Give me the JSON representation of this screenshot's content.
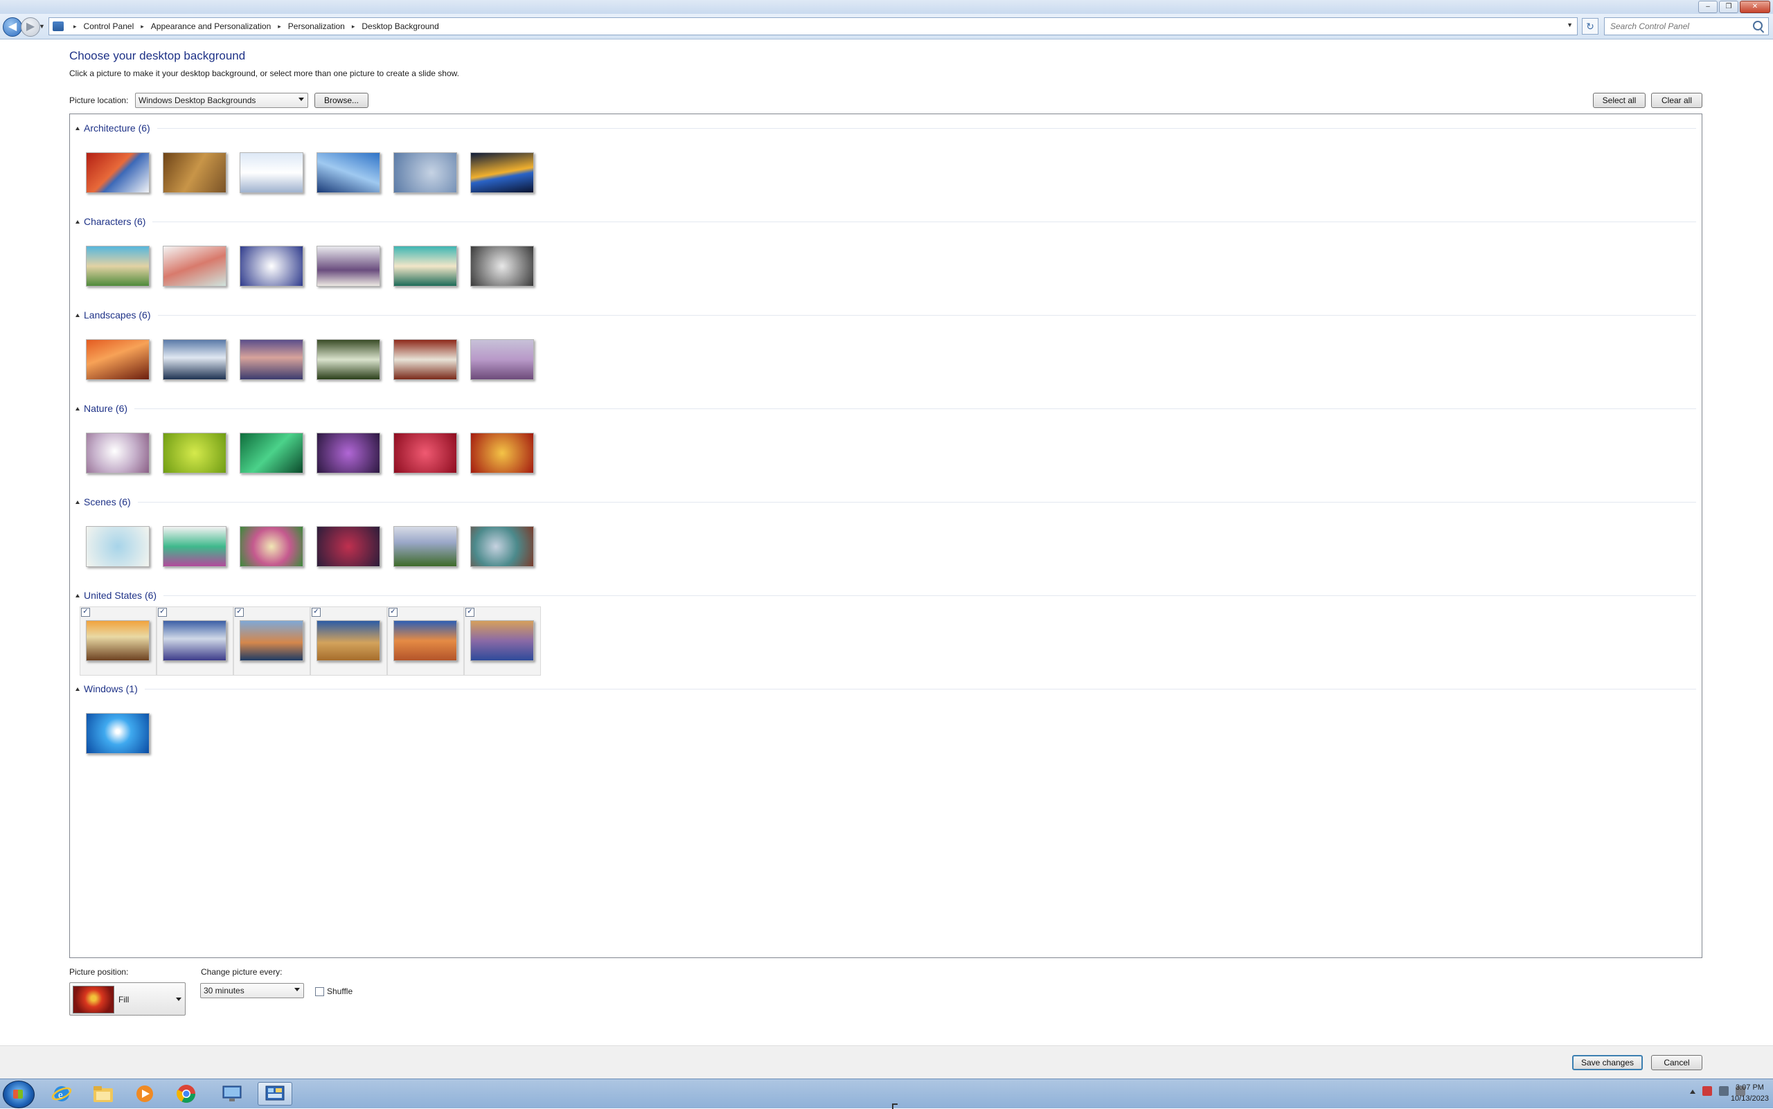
{
  "window": {
    "controls": [
      "–",
      "❐",
      "✕"
    ]
  },
  "nav": {
    "breadcrumb": [
      "Control Panel",
      "Appearance and Personalization",
      "Personalization",
      "Desktop Background"
    ],
    "search_placeholder": "Search Control Panel"
  },
  "page": {
    "heading": "Choose your desktop background",
    "subtitle": "Click a picture to make it your desktop background, or select more than one picture to create a slide show.",
    "location_label": "Picture location:",
    "location_value": "Windows Desktop Backgrounds",
    "browse_label": "Browse...",
    "select_all_label": "Select all",
    "clear_all_label": "Clear all"
  },
  "groups": [
    {
      "title": "Architecture (6)",
      "selected": false,
      "thumbs": [
        "linear-gradient(135deg,#b32014,#e86a3a 45%,#3c69b8 55%,#f0f2f6)",
        "linear-gradient(120deg,#6e4418,#c89548 50%,#7a5327)",
        "linear-gradient(180deg,#dde8f6,#ffffff 50%,#9fb2cf)",
        "linear-gradient(200deg,#2f73c7,#9fc9f0 50%,#1a3b78)",
        "radial-gradient(circle at 60% 50%,#c6d3e4,#5a7aa6)",
        "linear-gradient(170deg,#0d1b3a,#f1b02e 50%,#2a63c6 60%,#0b1430)"
      ]
    },
    {
      "title": "Characters (6)",
      "selected": false,
      "thumbs": [
        "linear-gradient(180deg,#57b6dc,#e2d2a4 50%,#4f8a3b)",
        "linear-gradient(160deg,#f4f4f4,#d87a6c 50%,#cfe3dd)",
        "radial-gradient(circle at 50% 50%,#ffffff,#2f3b8c)",
        "linear-gradient(180deg,#e9e9ed,#6a4d7e 60%,#ece8e2)",
        "linear-gradient(180deg,#3fb6b3,#f2e6c8 50%,#1d6b58)",
        "radial-gradient(circle at 50% 50%,#e8e8e8,#3a3a3a)"
      ]
    },
    {
      "title": "Landscapes (6)",
      "selected": false,
      "thumbs": [
        "linear-gradient(160deg,#e35b21,#f7a257 40%,#6b1e0e)",
        "linear-gradient(180deg,#5a7aa8,#dfe7f1 45%,#1f3352)",
        "linear-gradient(180deg,#5b4e8a,#d7a39b 45%,#3c3b6e)",
        "linear-gradient(180deg,#3a4c27,#d9e2cc 50%,#2b3f1a)",
        "linear-gradient(180deg,#8e2a1b,#e8e2d6 50%,#7a2a1a)",
        "linear-gradient(180deg,#c7c1d8,#b899c8 50%,#6d4b7a)"
      ]
    },
    {
      "title": "Nature (6)",
      "selected": false,
      "thumbs": [
        "radial-gradient(circle at 45% 45%,#ffffff,#c7b2cc 50%,#8a5f86)",
        "radial-gradient(circle at 50% 50%,#d5ea4c,#6f9c13)",
        "linear-gradient(135deg,#0f6d3c,#4bd28a 50%,#0b4a2b)",
        "radial-gradient(circle at 50% 50%,#b167d6,#2c1840)",
        "radial-gradient(circle at 50% 50%,#f05a72,#8d0c1f)",
        "radial-gradient(circle at 50% 50%,#f4c447,#a31a0f)"
      ]
    },
    {
      "title": "Scenes (6)",
      "selected": false,
      "thumbs": [
        "radial-gradient(circle at 50% 50%,#a7d4e9,#f3f4ef)",
        "linear-gradient(180deg,#f2f2f2,#3fb98c 50%,#b24a9b)",
        "radial-gradient(circle at 50% 50%,#f1e7b5,#c55a8f 50%,#3c8a3a)",
        "radial-gradient(circle at 50% 50%,#c0304f,#2b1d3a)",
        "linear-gradient(180deg,#d7dbe6,#9aa7c8 40%,#3f6b2a)",
        "radial-gradient(circle at 40% 50%,#c6d2e0,#4c8a8c 50%,#7a3c2c)"
      ]
    },
    {
      "title": "United States (6)",
      "selected": true,
      "thumbs": [
        "linear-gradient(180deg,#f1a33d,#e9d9a4 40%,#6d4221)",
        "linear-gradient(180deg,#3c5fa6,#cfd8e7 45%,#3d3c8a)",
        "linear-gradient(180deg,#7fa8d6,#d4874c 55%,#1e3b64)",
        "linear-gradient(180deg,#2c5ca5,#d3a35c 55%,#a66d2c)",
        "linear-gradient(180deg,#2f5fb3,#e58b45 50%,#b3542a)",
        "linear-gradient(180deg,#d6a05c,#8a6aa6 50%,#2e4a9a)"
      ]
    },
    {
      "title": "Windows (1)",
      "selected": false,
      "thumbs": [
        "radial-gradient(circle at 50% 45%,#ffffff 5%,#3fa9ef 35%,#0a4ba3)"
      ]
    }
  ],
  "settings": {
    "position_label": "Picture position:",
    "position_value": "Fill",
    "change_label": "Change picture every:",
    "change_value": "30 minutes",
    "shuffle_label": "Shuffle"
  },
  "footer": {
    "save_label": "Save changes",
    "cancel_label": "Cancel"
  },
  "taskbar": {
    "time": "3:07 PM",
    "date": "10/13/2023"
  }
}
